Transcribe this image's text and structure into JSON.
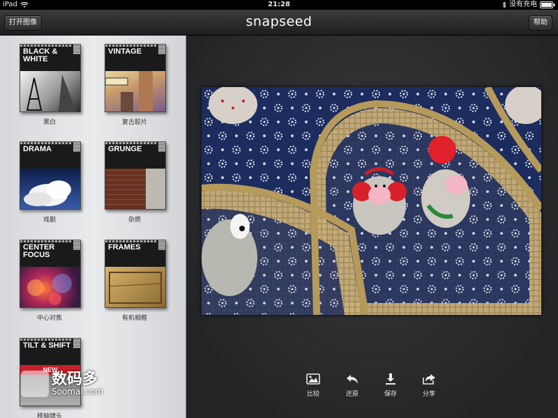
{
  "status_bar": {
    "device": "iPad",
    "time": "21:28",
    "charging": "没有充电"
  },
  "nav": {
    "title": "snapseed",
    "open_image": "打开图像",
    "help": "帮助"
  },
  "filters": [
    {
      "name": "BLACK & WHITE",
      "label_cn": "黑白"
    },
    {
      "name": "VINTAGE",
      "label_cn": "复古胶片"
    },
    {
      "name": "DRAMA",
      "label_cn": "戏剧"
    },
    {
      "name": "GRUNGE",
      "label_cn": "杂质"
    },
    {
      "name": "CENTER FOCUS",
      "label_cn": "中心对焦"
    },
    {
      "name": "FRAMES",
      "label_cn": "有机相框"
    },
    {
      "name": "TILT & SHIFT",
      "label_cn": "移轴镜头",
      "badge": "NEW"
    }
  ],
  "toolbar": [
    {
      "label": "比较",
      "icon": "image-icon"
    },
    {
      "label": "还原",
      "icon": "undo-icon"
    },
    {
      "label": "保存",
      "icon": "download-icon"
    },
    {
      "label": "分享",
      "icon": "share-icon"
    }
  ],
  "watermark": {
    "cn": "数码多",
    "en": "Soomal.com"
  },
  "colors": {
    "accent_red": "#c8202a",
    "nav_dark": "#1d1e20",
    "sidebar": "#e2e3e5"
  }
}
